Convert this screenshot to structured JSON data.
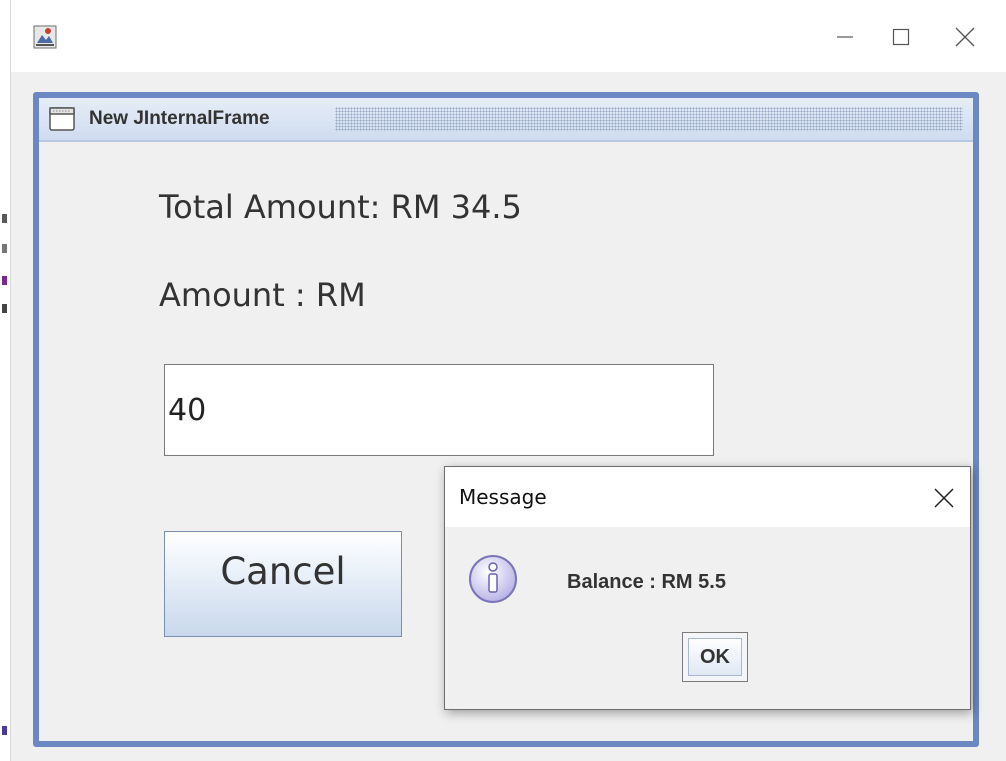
{
  "window": {
    "icon": "java-app-icon",
    "controls": [
      "minimize-icon",
      "maximize-icon",
      "close-icon"
    ]
  },
  "internal_frame": {
    "title": "New JInternalFrame",
    "icon": "window-frame-icon",
    "border_color": "#6b88c2"
  },
  "form": {
    "total_label": "Total Amount: RM 34.5",
    "amount_label": "Amount : RM",
    "amount_value": "40",
    "cancel_label": "Cancel"
  },
  "dialog": {
    "title": "Message",
    "icon": "info-icon",
    "message": "Balance : RM 5.5",
    "ok_label": "OK"
  }
}
